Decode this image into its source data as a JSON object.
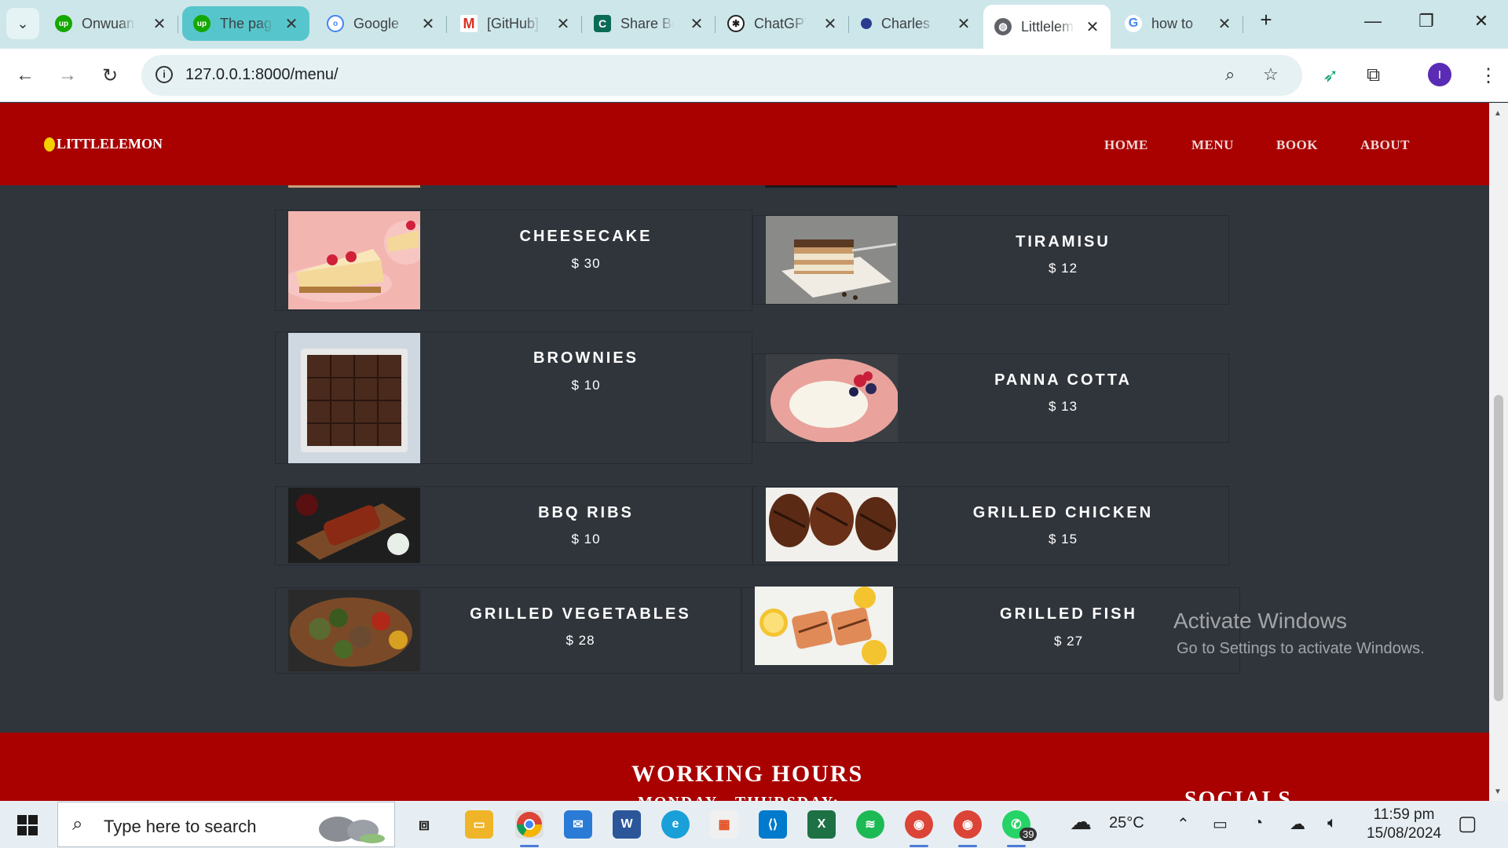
{
  "browser": {
    "tabs": [
      {
        "label": "Onwuanaku",
        "favicon": "upwork-icon",
        "color": "#14a800"
      },
      {
        "label": "The page",
        "favicon": "upwork-icon",
        "color": "#14a800"
      },
      {
        "label": "Google",
        "favicon": "google-icon",
        "color": "#4285f4"
      },
      {
        "label": "[GitHub]",
        "favicon": "gmail-icon",
        "color": "#d93025"
      },
      {
        "label": "Share Bo",
        "favicon": "coursera-icon",
        "color": "#0b6b56"
      },
      {
        "label": "ChatGPT",
        "favicon": "chatgpt-icon",
        "color": "#222222"
      },
      {
        "label": "Charles",
        "favicon": "profile-icon",
        "color": "#2a3b8f"
      },
      {
        "label": "Littlelemon",
        "favicon": "globe-icon",
        "color": "#5f6368"
      },
      {
        "label": "how to",
        "favicon": "google-g-icon",
        "color": "#4285f4"
      }
    ],
    "url": "127.0.0.1:8000/menu/"
  },
  "site": {
    "logo": "LITTLELEMON",
    "nav": [
      "HOME",
      "MENU",
      "BOOK",
      "ABOUT"
    ]
  },
  "menu_items": [
    {
      "name": "CHEESECAKE",
      "price": "$ 30"
    },
    {
      "name": "TIRAMISU",
      "price": "$ 12"
    },
    {
      "name": "BROWNIES",
      "price": "$ 10"
    },
    {
      "name": "PANNA COTTA",
      "price": "$ 13"
    },
    {
      "name": "BBQ RIBS",
      "price": "$ 10"
    },
    {
      "name": "GRILLED CHICKEN",
      "price": "$ 15"
    },
    {
      "name": "GRILLED VEGETABLES",
      "price": "$ 28"
    },
    {
      "name": "GRILLED FISH",
      "price": "$ 27"
    }
  ],
  "footer": {
    "working_hours": "WORKING HOURS",
    "days": "MONDAY - THURSDAY:",
    "socials": "SOCIALS"
  },
  "watermark": {
    "line1": "Activate Windows",
    "line2": "Go to Settings to activate Windows."
  },
  "taskbar": {
    "search_placeholder": "Type here to search",
    "whatsapp_badge": "39",
    "temperature": "25°C",
    "time": "11:59 pm",
    "date": "15/08/2024"
  }
}
